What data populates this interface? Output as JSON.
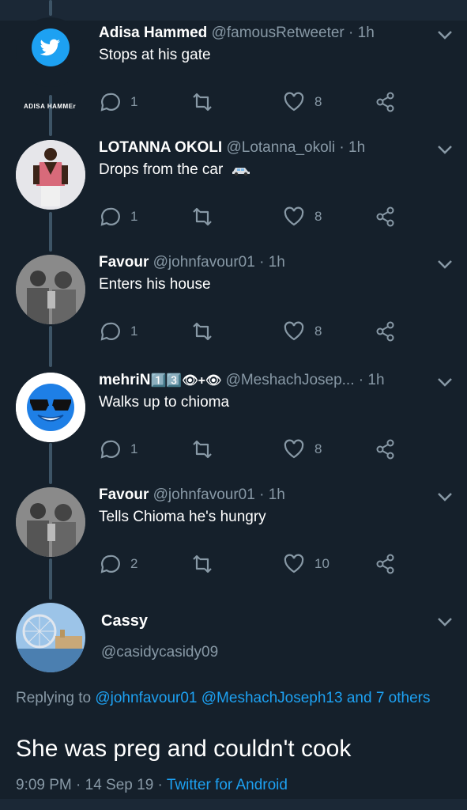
{
  "colors": {
    "background": "#15202b",
    "accent": "#1da1f2",
    "muted": "#8899a6"
  },
  "tweets": [
    {
      "name": "Adisa Hammed",
      "handle": "@famousRetweeter",
      "time": "1h",
      "text": "Stops at his gate",
      "replies": "1",
      "likes": "8",
      "avatar_label": "ADISA HAMMEr",
      "avatar_icon": "twitter-bird-icon"
    },
    {
      "name": "LOTANNA OKOLI",
      "handle": "@Lotanna_okoli",
      "time": "1h",
      "text": "Drops from the car",
      "emoji": "car-icon",
      "replies": "1",
      "likes": "8"
    },
    {
      "name": "Favour",
      "handle": "@johnfavour01",
      "time": "1h",
      "text": "Enters his house",
      "replies": "1",
      "likes": "8"
    },
    {
      "name": "mehriN",
      "name_suffix": "1️⃣3️⃣👁+👁",
      "handle": "@MeshachJosep...",
      "time": "1h",
      "text": "Walks up to chioma",
      "replies": "1",
      "likes": "8",
      "avatar_icon": "sunglasses-emoji-icon"
    },
    {
      "name": "Favour",
      "handle": "@johnfavour01",
      "time": "1h",
      "text": "Tells Chioma he's hungry",
      "replies": "2",
      "likes": "10"
    }
  ],
  "main": {
    "name": "Cassy",
    "handle": "@casidycasidy09",
    "replying_prefix": "Replying to",
    "replying_links": "@johnfavour01 @MeshachJoseph13 and 7 others",
    "text": "She was preg and couldn't cook",
    "time": "9:09 PM · 14 Sep 19 ·",
    "source": "Twitter for Android"
  }
}
